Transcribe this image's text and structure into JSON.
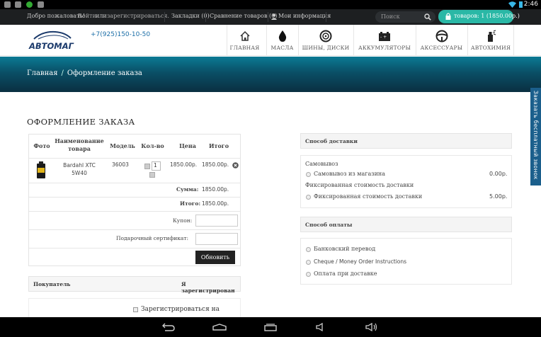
{
  "status_bar": {
    "time": "2:46"
  },
  "topbar": {
    "welcome": "Добро пожаловать!",
    "login": "Войти",
    "or": "или",
    "register": "зарегистрироваться.",
    "bookmarks": "Закладки (0)",
    "compare": "Сравнение товаров (0)",
    "account": "Мои информация",
    "search_placeholder": "Поиск",
    "cart": "товаров: 1 (1850.00р.)"
  },
  "header": {
    "logo_text": "АВТОМАГ",
    "phone": "+7(925)150-10-50",
    "nav": [
      {
        "label": "ГЛАВНАЯ",
        "icon": "home-icon"
      },
      {
        "label": "МАСЛА",
        "icon": "oil-drop-icon"
      },
      {
        "label": "ШИНЫ, ДИСКИ",
        "icon": "tire-icon"
      },
      {
        "label": "АККУМУЛЯТОРЫ",
        "icon": "battery-icon"
      },
      {
        "label": "АКСЕССУАРЫ",
        "icon": "steering-wheel-icon"
      },
      {
        "label": "АВТОХИМИЯ",
        "icon": "spray-icon"
      }
    ]
  },
  "breadcrumb": {
    "home": "Главная",
    "separator": "/",
    "current": "Оформление заказа"
  },
  "side_tab": "Заказать бесплатный звонок",
  "checkout": {
    "title": "ОФОРМЛЕНИЕ ЗАКАЗА",
    "columns": {
      "photo": "Фото",
      "name": "Наименование товара",
      "model": "Модель",
      "qty": "Кол-во",
      "price": "Цена",
      "total": "Итого"
    },
    "item": {
      "name": "Bardahl XTC 5W40",
      "model": "36003",
      "qty": "1",
      "price": "1850.00р.",
      "total": "1850.00р."
    },
    "sum_label": "Сумма:",
    "sum_value": "1850.00р.",
    "total_label": "Итого:",
    "total_value": "1850.00р.",
    "coupon_label": "Купон:",
    "voucher_label": "Подарочный сертификат:",
    "update_button": "Обновить",
    "buyer_label": "Покупатель",
    "registered_label": "Я зарегистрирован",
    "register_checkbox": "Зарегистрироваться на"
  },
  "delivery": {
    "title": "Способ доставки",
    "pickup_group": "Самовывоз",
    "pickup_option": "Самовывоз из магазина",
    "pickup_price": "0.00р.",
    "fixed_group": "Фиксированная стоимость доставки",
    "fixed_option": "Фиксированная стоимость доставки",
    "fixed_price": "5.00р."
  },
  "payment": {
    "title": "Способ оплаты",
    "options": [
      "Банковский перевод",
      "Cheque / Money Order Instructions",
      "Оплата при доставке"
    ]
  }
}
